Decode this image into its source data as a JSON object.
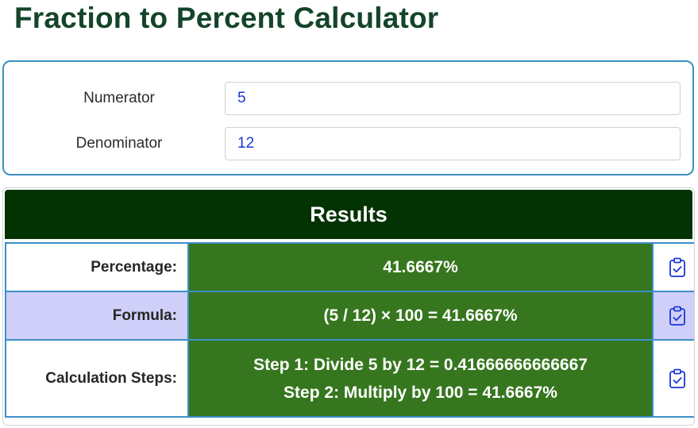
{
  "page": {
    "title": "Fraction to Percent Calculator"
  },
  "inputs": {
    "numerator": {
      "label": "Numerator",
      "value": "5"
    },
    "denominator": {
      "label": "Denominator",
      "value": "12"
    }
  },
  "results": {
    "header": "Results",
    "rows": [
      {
        "label": "Percentage:",
        "value": "41.6667%",
        "copy_icon": "clipboard-check-icon"
      },
      {
        "label": "Formula:",
        "value": "(5 / 12) × 100 = 41.6667%",
        "copy_icon": "clipboard-check-icon"
      },
      {
        "label": "Calculation Steps:",
        "steps": [
          "Step 1: Divide 5 by 12 = 0.41666666666667",
          "Step 2: Multiply by 100 = 41.6667%"
        ],
        "copy_icon": "clipboard-check-icon"
      }
    ]
  },
  "colors": {
    "title": "#14442a",
    "card_border": "#3d8fc6",
    "results_header_bg": "#033303",
    "value_cell_bg": "#36761e",
    "formula_row_bg": "#cfcffa",
    "input_text": "#1a36d4",
    "icon": "#1a36d4"
  }
}
